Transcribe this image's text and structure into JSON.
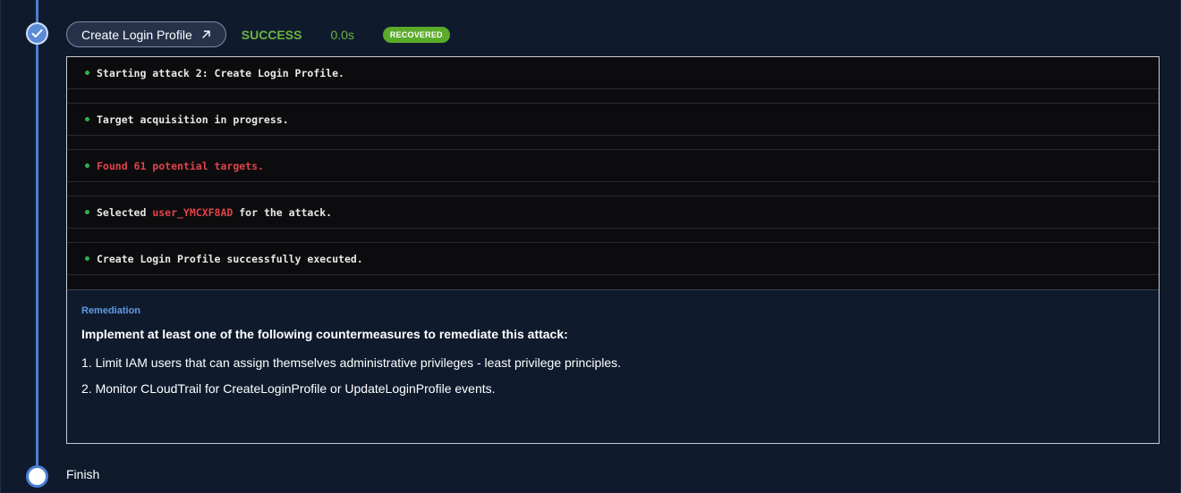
{
  "step": {
    "name": "Create Login Profile",
    "status": "SUCCESS",
    "duration": "0.0s",
    "badge": "RECOVERED",
    "icons": {
      "status": "checkmark-icon",
      "link": "external-link-arrow-icon"
    }
  },
  "log": {
    "lines": [
      {
        "text": "Starting attack 2: Create Login Profile."
      },
      {
        "text": "Target acquisition in progress."
      },
      {
        "text": "Found 61 potential targets."
      },
      {
        "prefix": "Selected ",
        "highlight": "user_YMCXF8AD",
        "suffix": " for the attack."
      },
      {
        "text": "Create Login Profile successfully executed."
      }
    ]
  },
  "remediation": {
    "label": "Remediation",
    "heading": "Implement at least one of the following countermeasures to remediate this attack:",
    "items": [
      "1. Limit IAM users that can assign themselves administrative privileges - least privilege principles.",
      "2. Monitor CLoudTrail for CreateLoginProfile or UpdateLoginProfile events."
    ]
  },
  "finish": {
    "label": "Finish"
  },
  "colors": {
    "background": "#0f1b2d",
    "timeline": "#4a7fd4",
    "success": "#6cb33f",
    "badge": "#5aab2a",
    "logBackground": "#0c0c0e",
    "logDot": "#2fb14a",
    "highlight": "#e0434b",
    "remediationLabel": "#5e9be6"
  }
}
